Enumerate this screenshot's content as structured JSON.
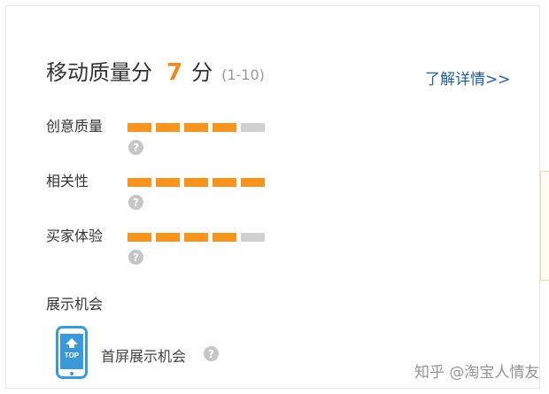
{
  "header": {
    "title": "移动质量分",
    "score": "7",
    "unit": "分",
    "range": "(1-10)",
    "detail_link": "了解详情>>"
  },
  "metrics": [
    {
      "label": "创意质量",
      "level": 4,
      "max": 5
    },
    {
      "label": "相关性",
      "level": 5,
      "max": 5
    },
    {
      "label": "买家体验",
      "level": 4,
      "max": 5
    }
  ],
  "help_glyph": "?",
  "opportunity": {
    "section_label": "展示机会",
    "icon_text": "TOP",
    "first_screen_label": "首屏展示机会"
  },
  "watermark": "知乎 @淘宝人情友",
  "colors": {
    "accent": "#f7941d",
    "score": "#f08a1c",
    "link": "#1f5fa8",
    "bar_off": "#d0d0d0",
    "phone": "#3a9ad9"
  },
  "icons": [
    "help-icon",
    "phone-top-icon"
  ]
}
